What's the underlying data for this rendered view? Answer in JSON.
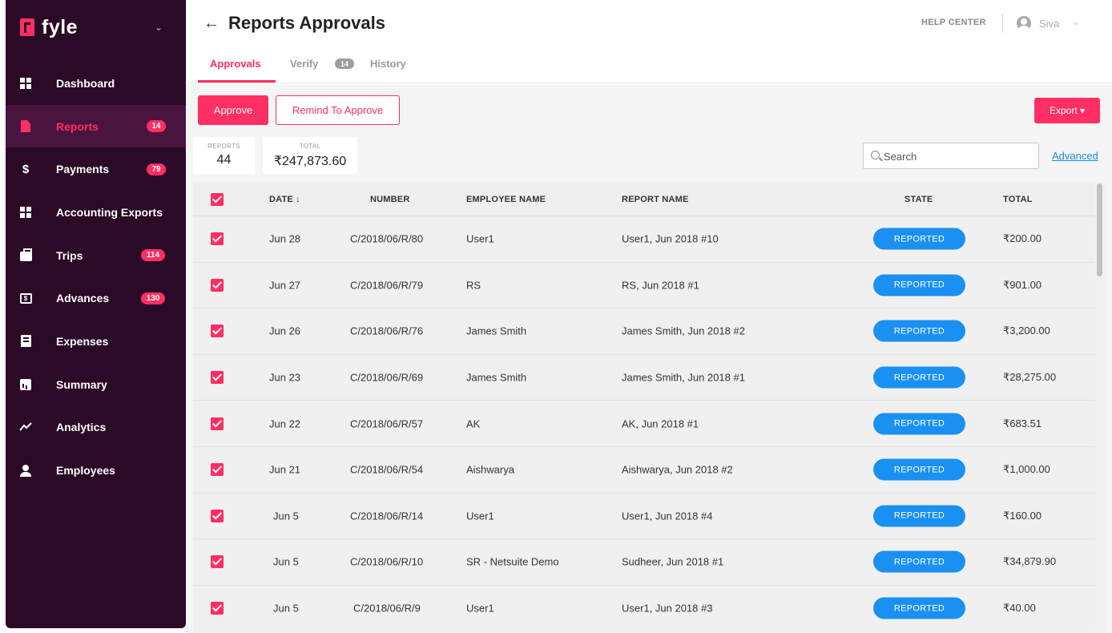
{
  "brand": {
    "name": "fyle"
  },
  "sidebar": {
    "items": [
      {
        "label": "Dashboard",
        "icon": "dashboard-icon",
        "badge": ""
      },
      {
        "label": "Reports",
        "icon": "report-icon",
        "badge": "14"
      },
      {
        "label": "Payments",
        "icon": "dollar-icon",
        "badge": "79"
      },
      {
        "label": "Accounting Exports",
        "icon": "dashboard-icon",
        "badge": ""
      },
      {
        "label": "Trips",
        "icon": "briefcase-icon",
        "badge": "114"
      },
      {
        "label": "Advances",
        "icon": "advance-icon",
        "badge": "130"
      },
      {
        "label": "Expenses",
        "icon": "receipt-icon",
        "badge": ""
      },
      {
        "label": "Summary",
        "icon": "bar-chart-icon",
        "badge": ""
      },
      {
        "label": "Analytics",
        "icon": "trend-icon",
        "badge": ""
      },
      {
        "label": "Employees",
        "icon": "user-icon",
        "badge": ""
      }
    ]
  },
  "header": {
    "back": "←",
    "title": "Reports Approvals",
    "help": "HELP CENTER",
    "user": "Siva"
  },
  "tabs": [
    {
      "label": "Approvals"
    },
    {
      "label": "Verify",
      "badge": "14"
    },
    {
      "label": "History"
    }
  ],
  "toolbar": {
    "approve": "Approve",
    "remind": "Remind To Approve",
    "export": "Export ▾"
  },
  "stats": {
    "reports_label": "REPORTS",
    "reports_value": "44",
    "total_label": "TOTAL",
    "total_value": "₹247,873.60"
  },
  "search": {
    "placeholder": "Search",
    "advanced": "Advanced"
  },
  "table": {
    "columns": [
      "DATE ↓",
      "NUMBER",
      "EMPLOYEE NAME",
      "REPORT NAME",
      "STATE",
      "TOTAL"
    ],
    "rows": [
      {
        "date": "Jun 28",
        "number": "C/2018/06/R/80",
        "employee": "User1",
        "report": "User1, Jun 2018 #10",
        "state": "REPORTED",
        "total": "₹200.00"
      },
      {
        "date": "Jun 27",
        "number": "C/2018/06/R/79",
        "employee": "RS",
        "report": "RS, Jun 2018 #1",
        "state": "REPORTED",
        "total": "₹901.00"
      },
      {
        "date": "Jun 26",
        "number": "C/2018/06/R/76",
        "employee": "James Smith",
        "report": "James Smith, Jun 2018 #2",
        "state": "REPORTED",
        "total": "₹3,200.00"
      },
      {
        "date": "Jun 23",
        "number": "C/2018/06/R/69",
        "employee": "James Smith",
        "report": "James Smith, Jun 2018 #1",
        "state": "REPORTED",
        "total": "₹28,275.00"
      },
      {
        "date": "Jun 22",
        "number": "C/2018/06/R/57",
        "employee": "AK",
        "report": "AK, Jun 2018 #1",
        "state": "REPORTED",
        "total": "₹683.51"
      },
      {
        "date": "Jun 21",
        "number": "C/2018/06/R/54",
        "employee": "Aishwarya",
        "report": "Aishwarya, Jun 2018 #2",
        "state": "REPORTED",
        "total": "₹1,000.00"
      },
      {
        "date": "Jun 5",
        "number": "C/2018/06/R/14",
        "employee": "User1",
        "report": "User1, Jun 2018 #4",
        "state": "REPORTED",
        "total": "₹160.00"
      },
      {
        "date": "Jun 5",
        "number": "C/2018/06/R/10",
        "employee": "SR - Netsuite Demo",
        "report": "Sudheer, Jun 2018 #1",
        "state": "REPORTED",
        "total": "₹34,879.90"
      },
      {
        "date": "Jun 5",
        "number": "C/2018/06/R/9",
        "employee": "User1",
        "report": "User1, Jun 2018 #3",
        "state": "REPORTED",
        "total": "₹40.00"
      }
    ]
  },
  "colors": {
    "sidebar": "#2b0a27",
    "accent": "#ff2e63",
    "state_pill": "#1a90f2",
    "link": "#1a8be0"
  }
}
